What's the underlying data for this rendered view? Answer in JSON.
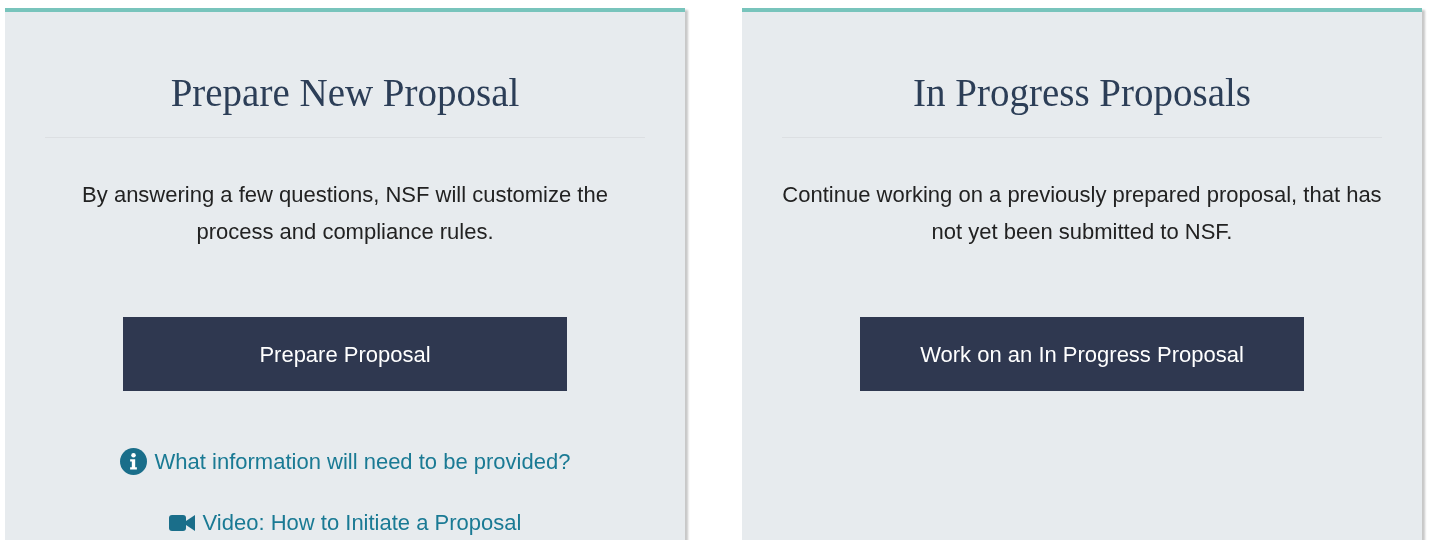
{
  "cards": [
    {
      "title": "Prepare New Proposal",
      "description": "By answering a few questions, NSF will customize the process and compliance rules.",
      "button": "Prepare Proposal",
      "links": [
        {
          "kind": "info",
          "label": "What information will need to be provided?"
        },
        {
          "kind": "video",
          "label": "Video: How to Initiate a Proposal"
        }
      ]
    },
    {
      "title": "In Progress Proposals",
      "description": "Continue working on a previously prepared proposal, that has not yet been submitted to NSF.",
      "button": "Work on an In Progress Proposal"
    }
  ]
}
